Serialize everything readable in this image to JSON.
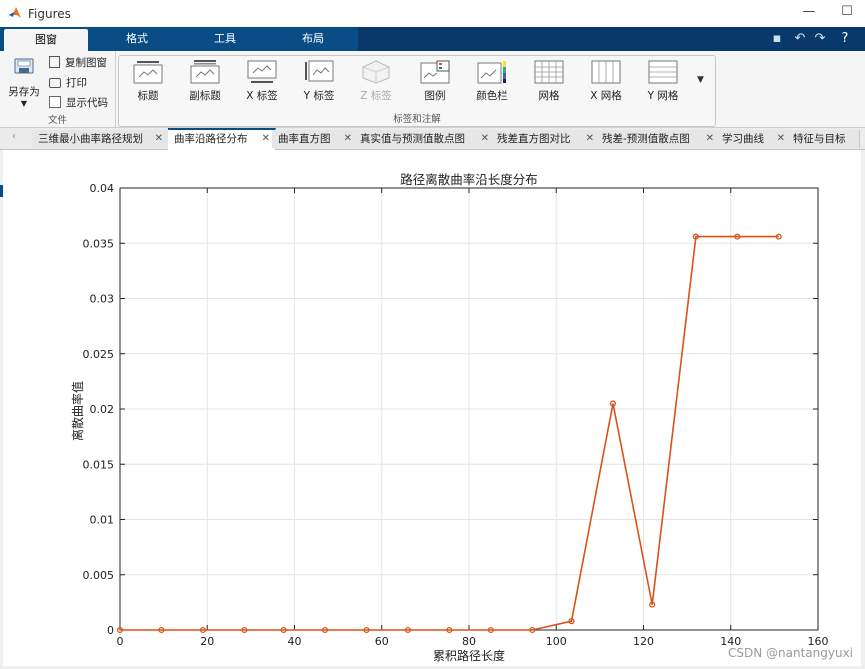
{
  "window": {
    "title": "Figures",
    "icon_name": "matlab-logo-icon",
    "controls": [
      "minimize-icon",
      "maximize-icon"
    ]
  },
  "ribbon_tabs": [
    {
      "label": "图窗",
      "active": true
    },
    {
      "label": "格式",
      "active": false
    },
    {
      "label": "工具",
      "active": false
    },
    {
      "label": "布局",
      "active": false
    }
  ],
  "quick_access": [
    "save-icon",
    "undo-icon",
    "redo-icon",
    "help-icon"
  ],
  "file_group": {
    "save_as": "另存为",
    "copy_figure": "复制图窗",
    "print": "打印",
    "show_code": "显示代码",
    "group_label": "文件"
  },
  "annotation_group": {
    "buttons": [
      {
        "label": "标题",
        "enabled": true
      },
      {
        "label": "副标题",
        "enabled": true
      },
      {
        "label": "X 标签",
        "enabled": true
      },
      {
        "label": "Y 标签",
        "enabled": true
      },
      {
        "label": "Z 标签",
        "enabled": false
      },
      {
        "label": "图例",
        "enabled": true
      },
      {
        "label": "颜色栏",
        "enabled": true
      },
      {
        "label": "网格",
        "enabled": true
      },
      {
        "label": "X 网格",
        "enabled": true
      },
      {
        "label": "Y 网格",
        "enabled": true
      }
    ],
    "group_label": "标签和注解"
  },
  "doc_tabs": [
    {
      "label": "三维最小曲率路径规划",
      "active": false
    },
    {
      "label": "曲率沿路径分布",
      "active": true
    },
    {
      "label": "曲率直方图",
      "active": false
    },
    {
      "label": "真实值与预测值散点图",
      "active": false
    },
    {
      "label": "残差直方图对比",
      "active": false
    },
    {
      "label": "残差-预测值散点图",
      "active": false
    },
    {
      "label": "学习曲线",
      "active": false
    },
    {
      "label": "特征与目标",
      "active": false
    }
  ],
  "chart_data": {
    "type": "line",
    "title": "路径离散曲率沿长度分布",
    "xlabel": "累积路径长度",
    "ylabel": "离散曲率值",
    "xlim": [
      0,
      160
    ],
    "ylim": [
      0,
      0.04
    ],
    "xticks": [
      "0",
      "20",
      "40",
      "60",
      "80",
      "100",
      "120",
      "140",
      "160"
    ],
    "yticks": [
      "0",
      "0.005",
      "0.01",
      "0.015",
      "0.02",
      "0.025",
      "0.03",
      "0.035",
      "0.04"
    ],
    "grid": true,
    "series": [
      {
        "color": "#d95319",
        "x": [
          0,
          9.5,
          19,
          28.5,
          37.5,
          47,
          56.5,
          66,
          75.5,
          85,
          94.5,
          103.5,
          113,
          122,
          132,
          141.5,
          151
        ],
        "y": [
          0,
          0,
          0,
          0,
          0,
          0,
          0,
          0,
          0,
          0,
          0,
          0.0008,
          0.0205,
          0.0023,
          0.0356,
          0.0356,
          0.0356
        ]
      }
    ]
  },
  "watermark": "CSDN @nantangyuxi"
}
